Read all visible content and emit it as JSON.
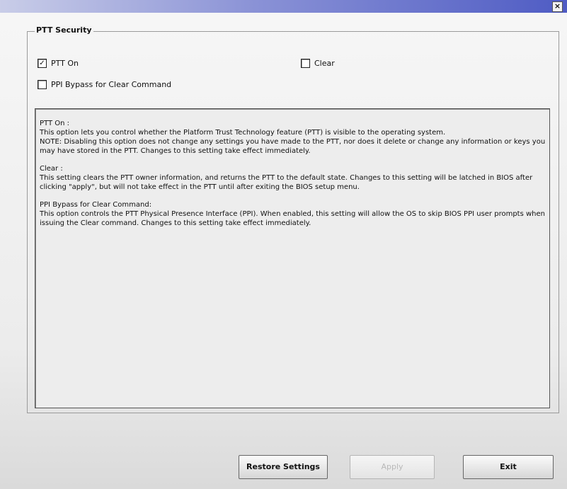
{
  "window": {
    "close_glyph": "×"
  },
  "group": {
    "legend": "PTT Security",
    "options": {
      "ptt_on": {
        "label": "PTT On",
        "checked": true,
        "mark": "✓"
      },
      "clear": {
        "label": "Clear",
        "checked": false,
        "mark": ""
      },
      "ppi_bypass": {
        "label": "PPI Bypass for Clear Command",
        "checked": false,
        "mark": ""
      }
    }
  },
  "help": {
    "ptt_on": {
      "heading": "PTT On :",
      "body": "This option lets you control whether the Platform Trust Technology feature (PTT) is visible to the operating system.\nNOTE: Disabling this option does not change any settings you have made to the PTT, nor does it delete or change any information or keys you may have stored in the PTT. Changes to this setting take effect immediately."
    },
    "clear": {
      "heading": "Clear :",
      "body": "This setting clears the PTT owner information, and returns the PTT to the default state. Changes to this setting will be latched in BIOS after clicking \"apply\", but will not take effect in the PTT until after exiting the BIOS setup menu."
    },
    "ppi_bypass": {
      "heading": "PPI Bypass for Clear Command:",
      "body": "This option controls the PTT Physical Presence Interface (PPI). When enabled, this setting will allow the OS to skip BIOS PPI user prompts when issuing the Clear command. Changes to this setting take effect immediately."
    }
  },
  "buttons": {
    "restore": "Restore Settings",
    "apply": "Apply",
    "exit": "Exit"
  }
}
